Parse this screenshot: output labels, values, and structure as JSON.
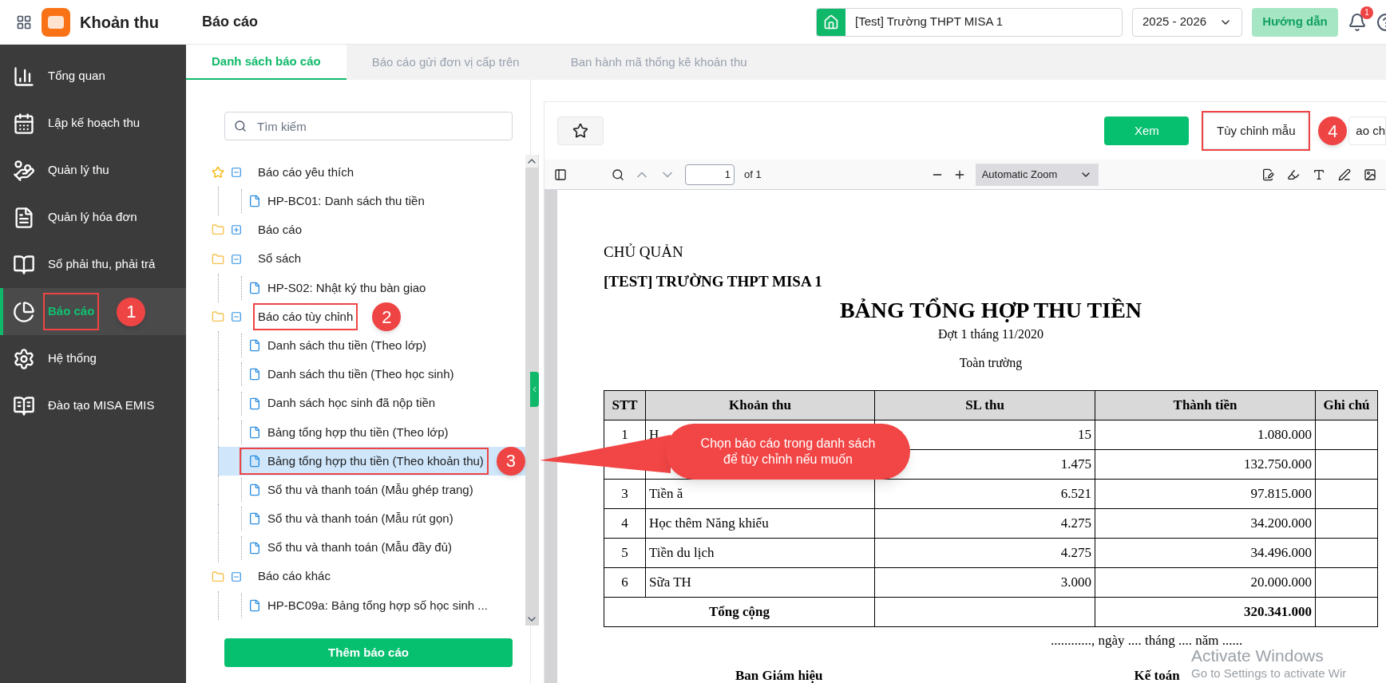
{
  "header": {
    "app_name": "Khoản thu",
    "page_title": "Báo cáo",
    "school": "[Test] Trường THPT MISA 1",
    "year": "2025 - 2026",
    "guide_button": "Hướng dẫn",
    "notification_count": "1"
  },
  "sidebar": {
    "items": [
      {
        "label": "Tổng quan",
        "selected": false,
        "marked": false
      },
      {
        "label": "Lập kế hoạch thu",
        "selected": false,
        "marked": false
      },
      {
        "label": "Quản lý thu",
        "selected": false,
        "marked": false
      },
      {
        "label": "Quản lý hóa đơn",
        "selected": false,
        "marked": false
      },
      {
        "label": "Sổ phải thu, phải trả",
        "selected": false,
        "marked": false
      },
      {
        "label": "Báo cáo",
        "selected": true,
        "marked": true,
        "step": "1"
      },
      {
        "label": "Hệ thống",
        "selected": false,
        "marked": false
      },
      {
        "label": "Đào tạo MISA EMIS",
        "selected": false,
        "marked": false
      }
    ]
  },
  "tabs": [
    {
      "label": "Danh sách báo cáo",
      "selected": true
    },
    {
      "label": "Báo cáo gửi đơn vị cấp trên",
      "selected": false
    },
    {
      "label": "Ban hành mã thống kê khoản thu",
      "selected": false
    }
  ],
  "report_panel": {
    "search": {
      "placeholder": "Tìm kiếm"
    },
    "tree": [
      {
        "label": "Báo cáo yêu thích",
        "kind": "favorite",
        "expanded": true,
        "marked": false,
        "children": [
          {
            "label": "HP-BC01: Danh sách thu tiền",
            "selected": false,
            "marked": false
          }
        ]
      },
      {
        "label": "Báo cáo",
        "kind": "folder",
        "expanded": false,
        "marked": false
      },
      {
        "label": "Sổ sách",
        "kind": "folder",
        "expanded": true,
        "marked": false,
        "children": [
          {
            "label": "HP-S02: Nhật ký thu bàn giao",
            "selected": false,
            "marked": false
          }
        ]
      },
      {
        "label": "Báo cáo tùy chỉnh",
        "kind": "folder",
        "expanded": true,
        "marked": true,
        "step": "2",
        "children": [
          {
            "label": "Danh sách thu tiền (Theo lớp)",
            "selected": false,
            "marked": false
          },
          {
            "label": "Danh sách thu tiền (Theo học sinh)",
            "selected": false,
            "marked": false
          },
          {
            "label": "Danh sách học sinh đã nộp tiền",
            "selected": false,
            "marked": false
          },
          {
            "label": "Bảng tổng hợp thu tiền (Theo lớp)",
            "selected": false,
            "marked": false
          },
          {
            "label": "Bảng tổng hợp thu tiền (Theo khoản thu)",
            "selected": true,
            "marked": true,
            "step": "3"
          },
          {
            "label": "Sổ thu và thanh toán (Mẫu ghép trang)",
            "selected": false,
            "marked": false
          },
          {
            "label": "Sổ thu và thanh toán (Mẫu rút gọn)",
            "selected": false,
            "marked": false
          },
          {
            "label": "Sổ thu và thanh toán (Mẫu đầy đủ)",
            "selected": false,
            "marked": false
          }
        ]
      },
      {
        "label": "Báo cáo khác",
        "kind": "folder",
        "expanded": true,
        "marked": false,
        "children": [
          {
            "label": "HP-BC09a: Bảng tổng hợp số học sinh ...",
            "selected": false,
            "marked": false
          }
        ]
      }
    ],
    "add_button": "Thêm báo cáo"
  },
  "viewer": {
    "view_button": "Xem",
    "customize_button": {
      "label": "Tùy chỉnh mẫu",
      "marked": true,
      "step": "4"
    },
    "cut_button": "ao ch",
    "pdf_toolbar": {
      "page": "1",
      "page_count": "of 1",
      "zoom": "Automatic Zoom"
    },
    "document": {
      "owner": "CHỦ QUẢN",
      "school": "[TEST] TRƯỜNG THPT MISA 1",
      "title": "BẢNG TỔNG HỢP THU TIỀN",
      "period": "Đợt 1 tháng 11/2020",
      "scope": "Toàn trường",
      "columns": [
        "STT",
        "Khoản thu",
        "SL thu",
        "Thành tiền",
        "Ghi chú"
      ],
      "rows": [
        {
          "stt": "1",
          "name": "H",
          "qty": "15",
          "amount": "1.080.000"
        },
        {
          "qty": "1.475",
          "amount": "132.750.000"
        },
        {
          "stt": "3",
          "name": "Tiền ă",
          "qty": "6.521",
          "amount": "97.815.000"
        },
        {
          "stt": "4",
          "name": "Học thêm Năng khiếu",
          "qty": "4.275",
          "amount": "34.200.000"
        },
        {
          "stt": "5",
          "name": "Tiền du lịch",
          "qty": "4.275",
          "amount": "34.496.000"
        },
        {
          "stt": "6",
          "name": "Sữa TH",
          "qty": "3.000",
          "amount": "20.000.000"
        }
      ],
      "total_label": "Tổng cộng",
      "total_amount": "320.341.000",
      "date_line": "............, ngày .... tháng .... năm ......",
      "signers": [
        "Ban Giám hiệu",
        "Kế toán"
      ]
    }
  },
  "callout": "Chọn báo cáo trong danh sách để tùy chỉnh nếu muốn",
  "os_notice": {
    "title": "Activate Windows",
    "text": "Go to Settings to activate Wir"
  }
}
